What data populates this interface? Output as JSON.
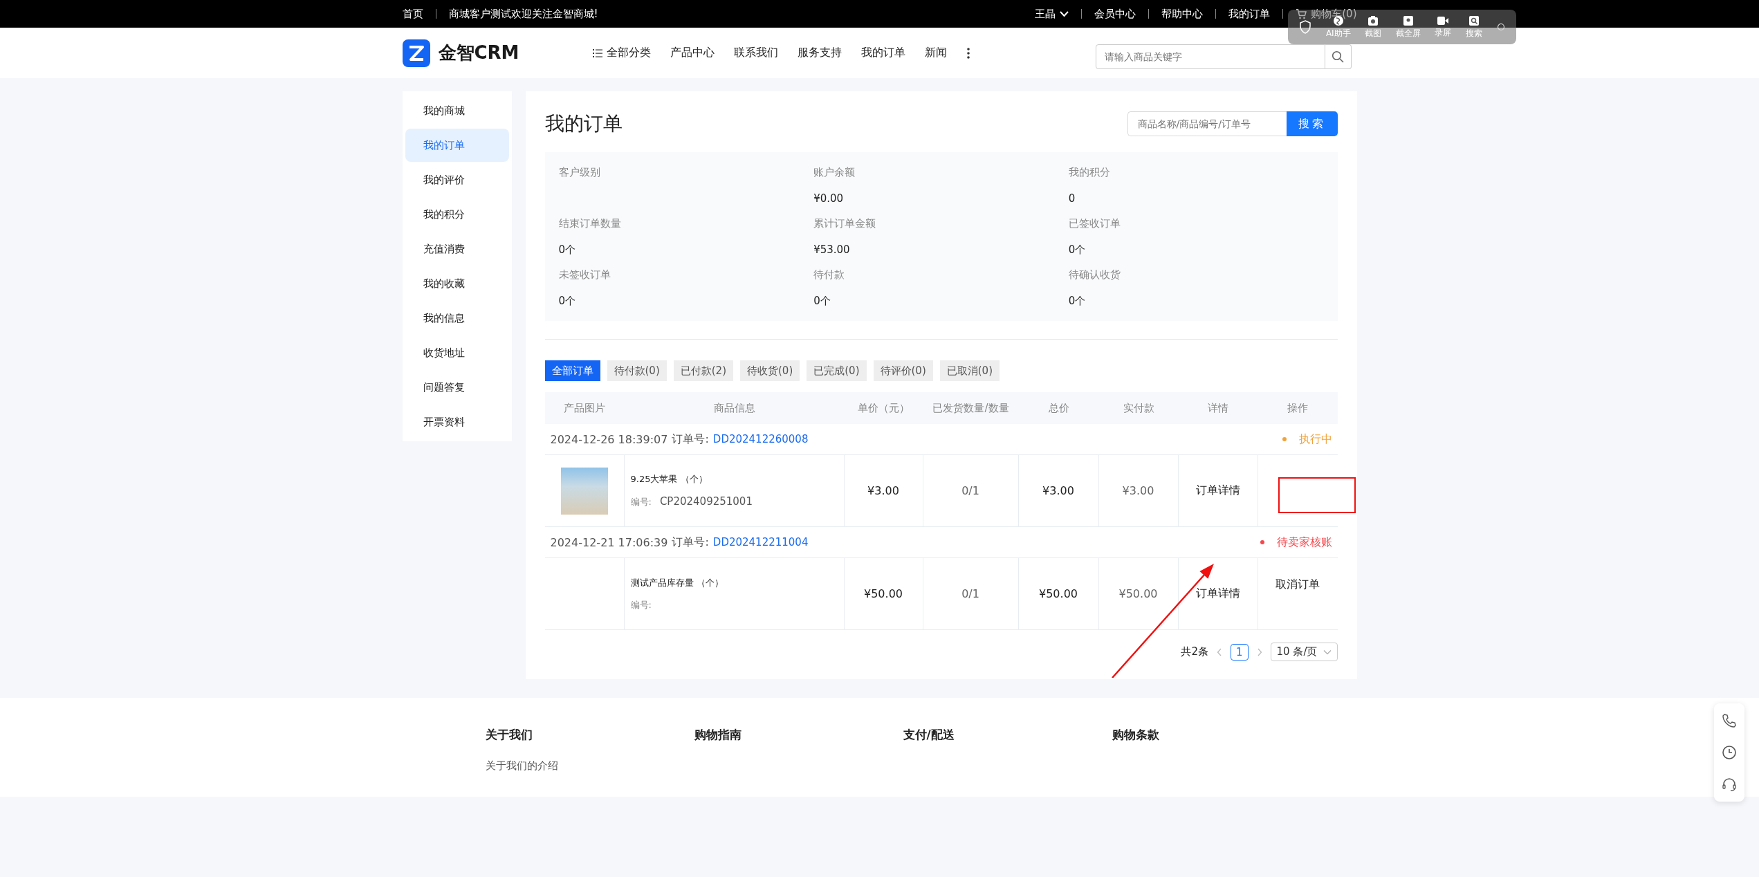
{
  "top_bar": {
    "left_links": [
      "首页",
      "商城客户测试欢迎关注金智商城!"
    ],
    "user": "王晶",
    "right_links": [
      "会员中心",
      "帮助中心",
      "我的订单"
    ],
    "cart": "购物车(0)"
  },
  "header": {
    "logo": "金智CRM",
    "nav": [
      {
        "kind": "category",
        "label": "全部分类"
      },
      {
        "kind": "link",
        "label": "产品中心"
      },
      {
        "kind": "link",
        "label": "联系我们"
      },
      {
        "kind": "link",
        "label": "服务支持"
      },
      {
        "kind": "link",
        "label": "我的订单"
      },
      {
        "kind": "link",
        "label": "新闻"
      },
      {
        "kind": "more"
      }
    ],
    "search": {
      "placeholder": "请输入商品关键字"
    }
  },
  "screen_tool": [
    {
      "kind": "shield"
    },
    {
      "kind": "ai",
      "label": "AI助手"
    },
    {
      "kind": "camera",
      "label": "截图"
    },
    {
      "kind": "full",
      "label": "截全屏"
    },
    {
      "kind": "record",
      "label": "录屏"
    },
    {
      "kind": "search",
      "label": "搜索"
    },
    {
      "kind": "more"
    }
  ],
  "sidebar": [
    {
      "label": "我的商城",
      "selected": false
    },
    {
      "label": "我的订单",
      "selected": true
    },
    {
      "label": "我的评价",
      "selected": false
    },
    {
      "label": "我的积分",
      "selected": false
    },
    {
      "label": "充值消费",
      "selected": false
    },
    {
      "label": "我的收藏",
      "selected": false
    },
    {
      "label": "我的信息",
      "selected": false
    },
    {
      "label": "收货地址",
      "selected": false
    },
    {
      "label": "问题答复",
      "selected": false
    },
    {
      "label": "开票资料",
      "selected": false
    }
  ],
  "title": "我的订单",
  "order_search": {
    "placeholder": "商品名称/商品编号/订单号",
    "button": "搜索"
  },
  "summary": [
    {
      "label": "客户级别"
    },
    {
      "label": "账户余额",
      "value": "¥0.00"
    },
    {
      "label": "我的积分",
      "value": "0"
    },
    {
      "label": "结束订单数量",
      "value": "0个"
    },
    {
      "label": "累计订单金额",
      "value": "¥53.00"
    },
    {
      "label": "已签收订单",
      "value": "0个"
    },
    {
      "label": "未签收订单",
      "value": "0个"
    },
    {
      "label": "待付款",
      "value": "0个"
    },
    {
      "label": "待确认收货",
      "value": "0个"
    }
  ],
  "tabs": [
    {
      "label": "全部订单",
      "selected": true
    },
    {
      "label": "待付款(0)",
      "selected": false
    },
    {
      "label": "已付款(2)",
      "selected": false
    },
    {
      "label": "待收货(0)",
      "selected": false
    },
    {
      "label": "已完成(0)",
      "selected": false
    },
    {
      "label": "待评价(0)",
      "selected": false
    },
    {
      "label": "已取消(0)",
      "selected": false
    }
  ],
  "table": {
    "columns": [
      "产品图片",
      "商品信息",
      "单价（元）",
      "已发货数量/数量",
      "总价",
      "实付款",
      "详情",
      "操作"
    ],
    "orders": [
      {
        "time": "2024-12-26 18:39:07",
        "order_no_label": "订单号:",
        "order_no": "DD202412260008",
        "status": "执行中",
        "color": "#f0a33a",
        "photo": true,
        "name": "9.25大苹果",
        "unit": "（个）",
        "code_label": "编号:",
        "code": "CP202409251001",
        "unit_price": "¥3.00",
        "shipped": "0/1",
        "total": "¥3.00",
        "paid": "¥3.00",
        "detail": "订单详情"
      },
      {
        "time": "2024-12-21 17:06:39",
        "order_no_label": "订单号:",
        "order_no": "DD202412211004",
        "status": "待卖家核账",
        "color": "#f5484d",
        "photo": false,
        "name": "测试产品库存量",
        "unit": "（个）",
        "code_label": "编号:",
        "unit_price": "¥50.00",
        "shipped": "0/1",
        "total": "¥50.00",
        "paid": "¥50.00",
        "detail": "订单详情",
        "action": "取消订单"
      }
    ]
  },
  "pagination": {
    "total": "共2条",
    "pages": [
      {
        "label": "1",
        "selected": true
      }
    ],
    "page_size": "10 条/页"
  },
  "footer": [
    {
      "title": "关于我们",
      "links": [
        "关于我们的介绍"
      ]
    },
    {
      "title": "购物指南"
    },
    {
      "title": "支付/配送"
    },
    {
      "title": "购物条款"
    }
  ]
}
